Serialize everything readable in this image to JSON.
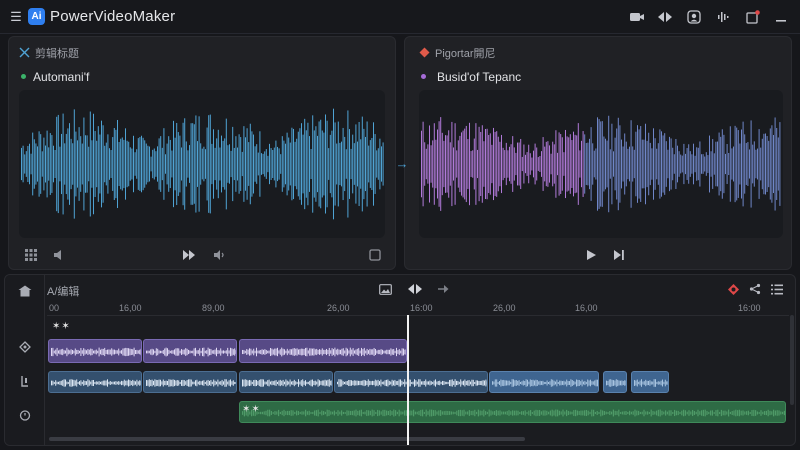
{
  "app": {
    "logo": "Ai",
    "title": "PowerVideoMaker"
  },
  "titlebar_icons": [
    "camera-icon",
    "split-icon",
    "user-icon",
    "waveform-icon",
    "notification-icon",
    "minimize-icon"
  ],
  "colors": {
    "accent_blue": "#4fa3d4",
    "accent_purple": "#b07ad8",
    "clip_purple": "#6a5a9e",
    "clip_blue": "#3c5f86",
    "clip_green": "#2e6b45",
    "notification": "#e04848"
  },
  "left_panel": {
    "title": "剪辑标题",
    "mode_label": "Automani'f",
    "mode_dot_color": "#3bb36a"
  },
  "right_panel": {
    "title": "Pigortar開尼",
    "mode_label": "Busid'of Tepanc",
    "mode_dot_color": "#a66cd8"
  },
  "timeline": {
    "label": "A/编辑",
    "ruler": [
      "00",
      "16,00",
      "89,00",
      "26,00",
      "16:00",
      "26,00",
      "16,00",
      "16:00"
    ],
    "marker_top": "✶✶",
    "marker_green": "✶✶"
  }
}
